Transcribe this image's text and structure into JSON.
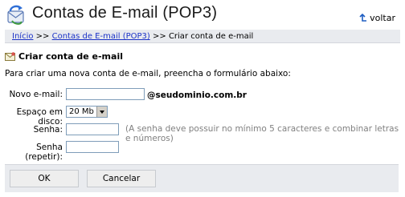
{
  "header": {
    "title": "Contas de E-mail (POP3)",
    "back_label": "voltar"
  },
  "breadcrumb": {
    "items": [
      "Início",
      "Contas de E-mail (POP3)",
      "Criar conta de e-mail"
    ],
    "separator": ">>"
  },
  "form": {
    "section_title": "Criar conta de e-mail",
    "intro": "Para criar uma nova conta de e-mail, preencha o formulário abaixo:",
    "email_label": "Novo e-mail:",
    "email_value": "",
    "domain_suffix": "@seudominio.com.br",
    "disk_label": "Espaço em disco:",
    "disk_value": "20 Mb",
    "password_label": "Senha:",
    "password_hint": "(A senha deve possuir no mínimo 5 caracteres e combinar letras e números)",
    "password_repeat_label": "Senha (repetir):"
  },
  "actions": {
    "ok_label": "OK",
    "cancel_label": "Cancelar"
  },
  "colors": {
    "accent": "#1c33c7",
    "bar_bg": "#e9ebef",
    "hint": "#808080"
  }
}
